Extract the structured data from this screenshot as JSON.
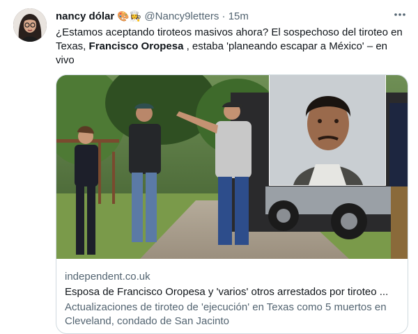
{
  "tweet": {
    "display_name": "nancy dólar",
    "name_emojis": "🎨👩‍🍳",
    "handle": "@Nancy9letters",
    "separator": "·",
    "timestamp": "15m",
    "text_part1": "¿Estamos aceptando tiroteos masivos ahora? El sospechoso del tiroteo en Texas, ",
    "text_bold": "Francisco Oropesa",
    "text_part2": " , estaba 'planeando escapar a México' – en vivo"
  },
  "card": {
    "domain": "independent.co.uk",
    "title": "Esposa de Francisco Oropesa y 'varios' otros arrestados por tiroteo ...",
    "description": "Actualizaciones de tiroteo de 'ejecución' en Texas como 5 muertos en Cleveland, condado de San Jacinto"
  },
  "colors": {
    "text": "#0f1419",
    "secondary": "#536471",
    "border": "#cfd9de"
  },
  "icons": {
    "more": "more-horizontal-icon"
  }
}
